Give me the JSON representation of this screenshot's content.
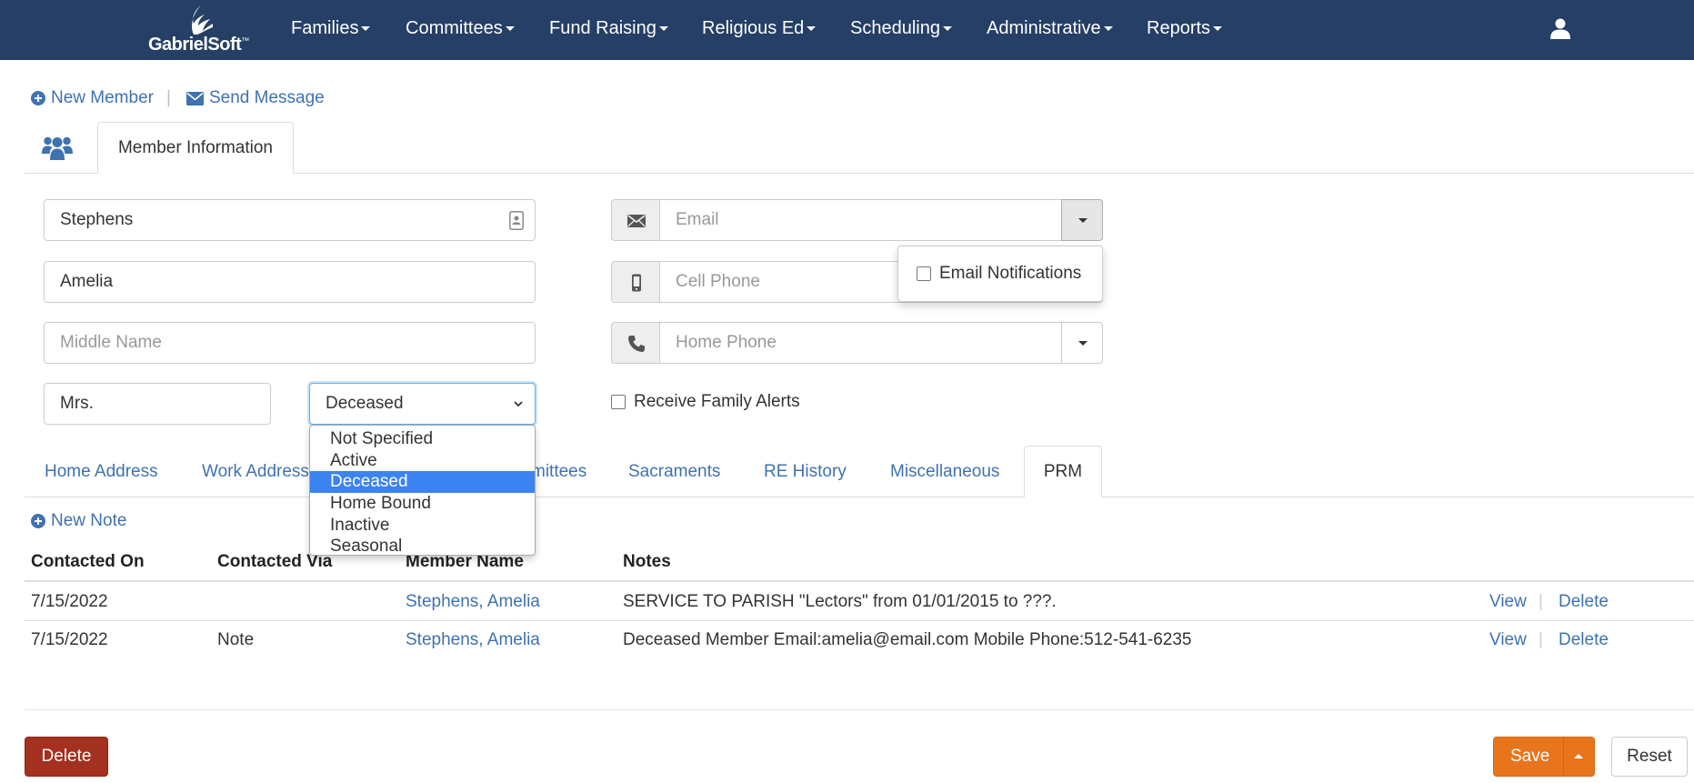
{
  "brand": {
    "name": "GabrielSoft",
    "mark": "™"
  },
  "nav": {
    "items": [
      {
        "label": "Families"
      },
      {
        "label": "Committees"
      },
      {
        "label": "Fund Raising"
      },
      {
        "label": "Religious Ed"
      },
      {
        "label": "Scheduling"
      },
      {
        "label": "Administrative"
      },
      {
        "label": "Reports"
      }
    ],
    "user_icon": "user-icon"
  },
  "actions": {
    "new_member": "New Member",
    "separator": "|",
    "send_message": "Send Message"
  },
  "top_tabs": {
    "member_information": "Member Information",
    "people_icon": "people-icon"
  },
  "form": {
    "last_name": "Stephens",
    "first_name": "Amelia",
    "middle_name_placeholder": "Middle Name",
    "title": "Mrs.",
    "status": "Deceased",
    "email_placeholder": "Email",
    "cell_phone_placeholder": "Cell Phone",
    "home_phone_placeholder": "Home Phone",
    "receive_family_alerts": "Receive Family Alerts",
    "email_notifications": "Email Notifications"
  },
  "status_options": [
    {
      "label": "Not Specified",
      "selected": false
    },
    {
      "label": "Active",
      "selected": false
    },
    {
      "label": "Deceased",
      "selected": true
    },
    {
      "label": "Home Bound",
      "selected": false
    },
    {
      "label": "Inactive",
      "selected": false
    },
    {
      "label": "Seasonal",
      "selected": false
    }
  ],
  "sub_tabs": {
    "home_address": "Home Address",
    "work_address": "Work Address",
    "committees_partial": "mittees",
    "sacraments": "Sacraments",
    "re_history": "RE History",
    "miscellaneous": "Miscellaneous",
    "prm": "PRM"
  },
  "prm": {
    "new_note": "New Note",
    "columns": [
      "Contacted On",
      "Contacted Via",
      "Member Name",
      "Notes"
    ],
    "rows": [
      {
        "contacted_on": "7/15/2022",
        "contacted_via": "",
        "member_name": "Stephens, Amelia",
        "notes": "SERVICE TO PARISH \"Lectors\" from 01/01/2015 to ???.",
        "view": "View",
        "sep": "|",
        "delete": "Delete"
      },
      {
        "contacted_on": "7/15/2022",
        "contacted_via": "Note",
        "member_name": "Stephens, Amelia",
        "notes": "Deceased Member Email:amelia@email.com Mobile Phone:512-541-6235",
        "view": "View",
        "sep": "|",
        "delete": "Delete"
      }
    ]
  },
  "footer": {
    "delete": "Delete",
    "save": "Save",
    "reset": "Reset"
  },
  "colors": {
    "nav_bg": "#253f66",
    "link": "#3f72b0",
    "save": "#e8741c",
    "delete": "#a4301f",
    "selected_option": "#3b83f0"
  }
}
